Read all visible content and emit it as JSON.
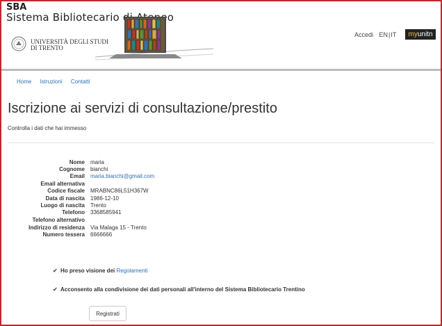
{
  "header": {
    "brand_abbr": "SBA",
    "brand_name": "Sistema Bibliotecario di Ateneo",
    "university_line1": "UNIVERSITÀ DEGLI STUDI",
    "university_line2": "DI TRENTO",
    "login": "Accedi",
    "lang_en": "EN",
    "lang_sep": "|",
    "lang_it": "IT",
    "myunitn_prefix": "my",
    "myunitn_suffix": "unitn"
  },
  "nav": {
    "items": [
      "Home",
      "Istruzioni",
      "Contatti"
    ]
  },
  "page": {
    "title": "Iscrizione ai servizi di consultazione/prestito",
    "subtitle": "Controlla i dati che hai immesso"
  },
  "fields": [
    {
      "label": "Nome",
      "value": "maria"
    },
    {
      "label": "Cognome",
      "value": "bianchi"
    },
    {
      "label": "Email",
      "value": "maria.bianchi@gmail.com"
    },
    {
      "label": "Email alternativa",
      "value": ""
    },
    {
      "label": "Codice fiscale",
      "value": "MRABNC86L51H367W"
    },
    {
      "label": "Data di nascita",
      "value": "1986-12-10"
    },
    {
      "label": "Luogo di nascita",
      "value": "Trento"
    },
    {
      "label": "Telefono",
      "value": "3368585941"
    },
    {
      "label": "Telefono alternativo",
      "value": ""
    },
    {
      "label": "Indirizzo di residenza",
      "value": "Via Malaga 15 - Trento"
    },
    {
      "label": "Numero tessera",
      "value": "6666666"
    }
  ],
  "checks": {
    "regolamenti_text": "Ho preso visione dei",
    "regolamenti_link": "Regolamenti",
    "consenso_text": "Acconsento alla condivisione dei dati personali all'interno del Sistema Bibliotecario Trentino"
  },
  "submit_label": "Registrati",
  "colors": {
    "link": "#2b6fb5",
    "frame": "#c1272d",
    "brand_bar": "#222222",
    "brand_accent": "#f1c232"
  }
}
